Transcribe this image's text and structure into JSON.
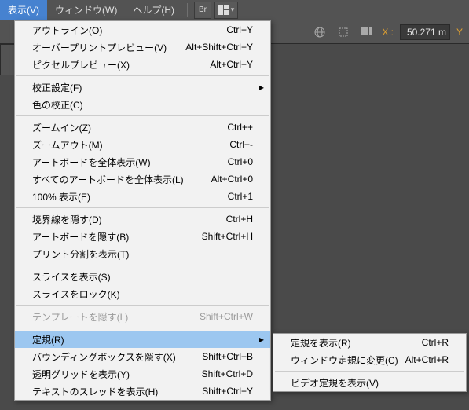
{
  "menubar": {
    "view": "表示(V)",
    "window": "ウィンドウ(W)",
    "help": "ヘルプ(H)",
    "br_label": "Br"
  },
  "coords": {
    "x_label": "X :",
    "x_value": "50.271 m",
    "y_label": "Y"
  },
  "menu": {
    "outline": {
      "l": "アウトライン(O)",
      "s": "Ctrl+Y"
    },
    "overprint": {
      "l": "オーバープリントプレビュー(V)",
      "s": "Alt+Shift+Ctrl+Y"
    },
    "pixel": {
      "l": "ピクセルプレビュー(X)",
      "s": "Alt+Ctrl+Y"
    },
    "proof_setup": {
      "l": "校正設定(F)"
    },
    "proof_colors": {
      "l": "色の校正(C)"
    },
    "zoom_in": {
      "l": "ズームイン(Z)",
      "s": "Ctrl++"
    },
    "zoom_out": {
      "l": "ズームアウト(M)",
      "s": "Ctrl+-"
    },
    "fit_artboard": {
      "l": "アートボードを全体表示(W)",
      "s": "Ctrl+0"
    },
    "fit_all": {
      "l": "すべてのアートボードを全体表示(L)",
      "s": "Alt+Ctrl+0"
    },
    "actual_size": {
      "l": "100% 表示(E)",
      "s": "Ctrl+1"
    },
    "hide_edges": {
      "l": "境界線を隠す(D)",
      "s": "Ctrl+H"
    },
    "hide_artboards": {
      "l": "アートボードを隠す(B)",
      "s": "Shift+Ctrl+H"
    },
    "show_print_tiling": {
      "l": "プリント分割を表示(T)"
    },
    "show_slices": {
      "l": "スライスを表示(S)"
    },
    "lock_slices": {
      "l": "スライスをロック(K)"
    },
    "hide_template": {
      "l": "テンプレートを隠す(L)",
      "s": "Shift+Ctrl+W"
    },
    "rulers": {
      "l": "定規(R)"
    },
    "hide_bb": {
      "l": "バウンディングボックスを隠す(X)",
      "s": "Shift+Ctrl+B"
    },
    "show_tgrid": {
      "l": "透明グリッドを表示(Y)",
      "s": "Shift+Ctrl+D"
    },
    "show_threads": {
      "l": "テキストのスレッドを表示(H)",
      "s": "Shift+Ctrl+Y"
    }
  },
  "submenu": {
    "show_rulers": {
      "l": "定規を表示(R)",
      "s": "Ctrl+R"
    },
    "change_window": {
      "l": "ウィンドウ定規に変更(C)",
      "s": "Alt+Ctrl+R"
    },
    "show_video": {
      "l": "ビデオ定規を表示(V)"
    }
  },
  "glyph": {
    "arrow_right": "▸",
    "dropdown": "▾"
  }
}
